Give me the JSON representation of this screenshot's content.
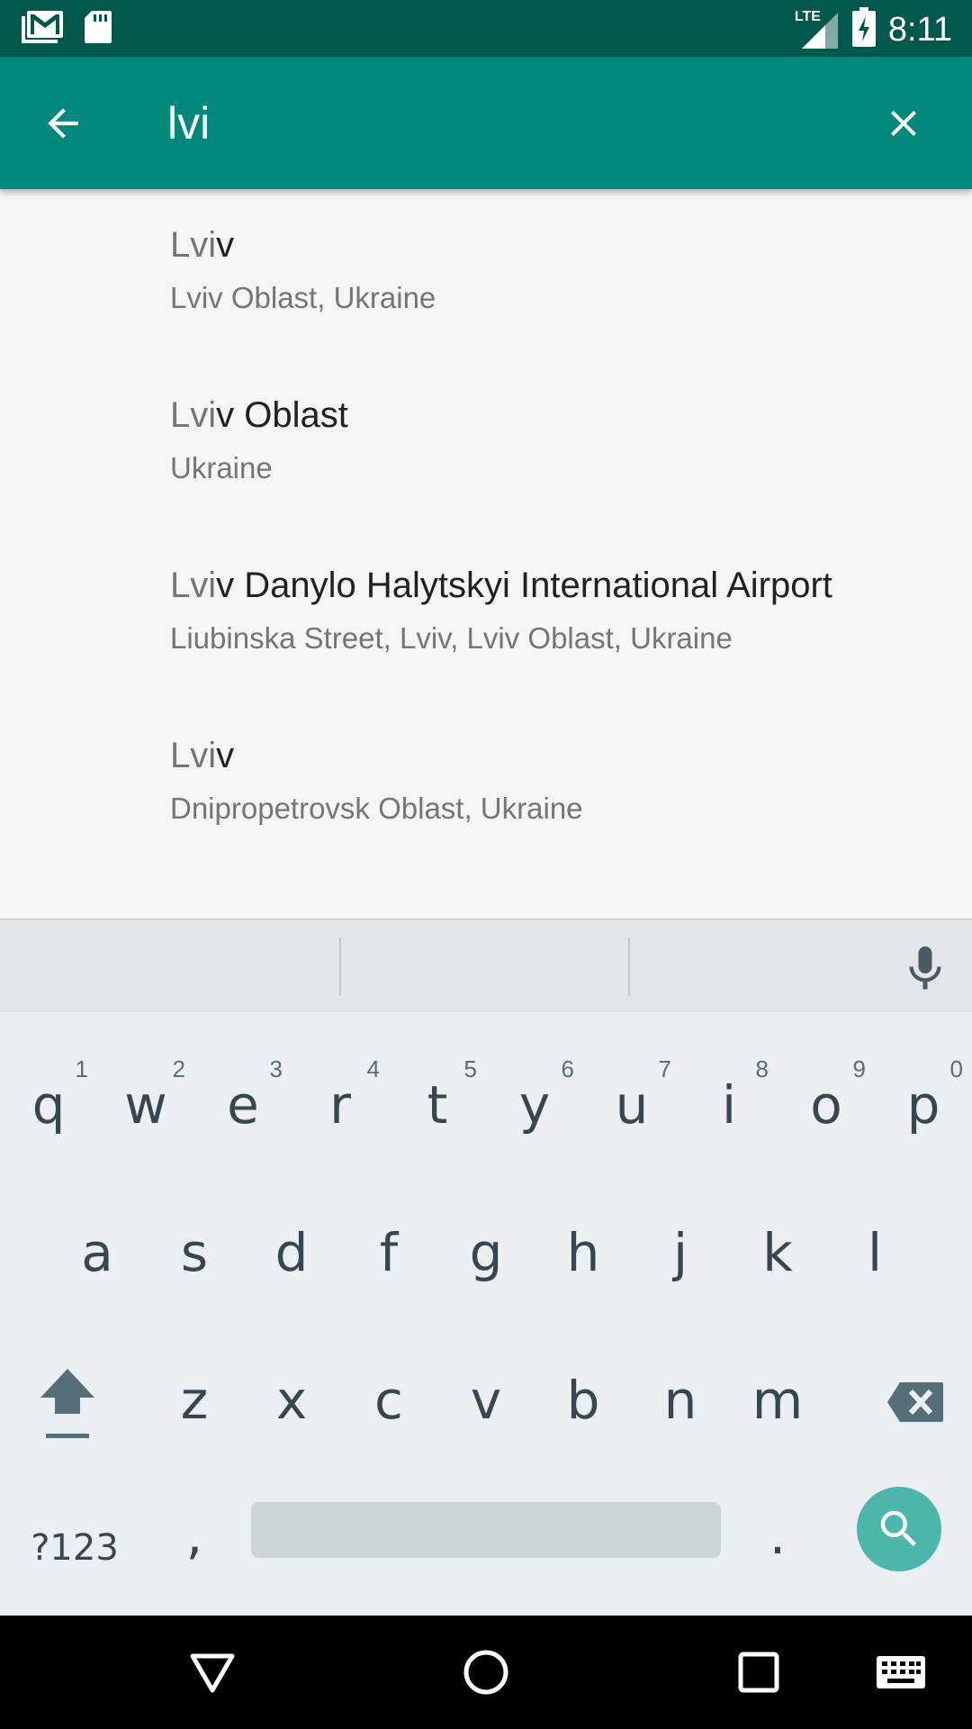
{
  "status_bar": {
    "network": "LTE",
    "time": "8:11",
    "icons": [
      "gmail-icon",
      "sd-card-icon",
      "lte-signal-icon",
      "battery-charging-icon"
    ]
  },
  "search": {
    "query": "lvi",
    "back_icon": "arrow-back-icon",
    "clear_icon": "close-icon"
  },
  "results": [
    {
      "match": "Lvi",
      "rest": "v",
      "subtitle": "Lviv Oblast, Ukraine"
    },
    {
      "match": "Lvi",
      "rest": "v Oblast",
      "subtitle": "Ukraine"
    },
    {
      "match": "Lvi",
      "rest": "v Danylo Halytskyi International Airport",
      "subtitle": "Liubinska Street, Lviv, Lviv Oblast, Ukraine"
    },
    {
      "match": "Lvi",
      "rest": "v",
      "subtitle": "Dnipropetrovsk Oblast, Ukraine"
    }
  ],
  "keyboard": {
    "row1": [
      "q",
      "w",
      "e",
      "r",
      "t",
      "y",
      "u",
      "i",
      "o",
      "p"
    ],
    "row1_hints": [
      "1",
      "2",
      "3",
      "4",
      "5",
      "6",
      "7",
      "8",
      "9",
      "0"
    ],
    "row2": [
      "a",
      "s",
      "d",
      "f",
      "g",
      "h",
      "j",
      "k",
      "l"
    ],
    "row3": [
      "z",
      "x",
      "c",
      "v",
      "b",
      "n",
      "m"
    ],
    "symbols_label": "?123",
    "comma": ",",
    "period": ".",
    "icons": [
      "mic-icon",
      "shift-icon",
      "backspace-icon",
      "search-icon"
    ]
  },
  "nav_bar": {
    "icons": [
      "back-triangle-icon",
      "home-circle-icon",
      "recents-square-icon",
      "keyboard-switch-icon"
    ]
  },
  "colors": {
    "status_bar": "#00574b",
    "app_bar": "#00897b",
    "accent": "#4db6ac",
    "background": "#f5f5f5",
    "keyboard": "#eceff1"
  }
}
